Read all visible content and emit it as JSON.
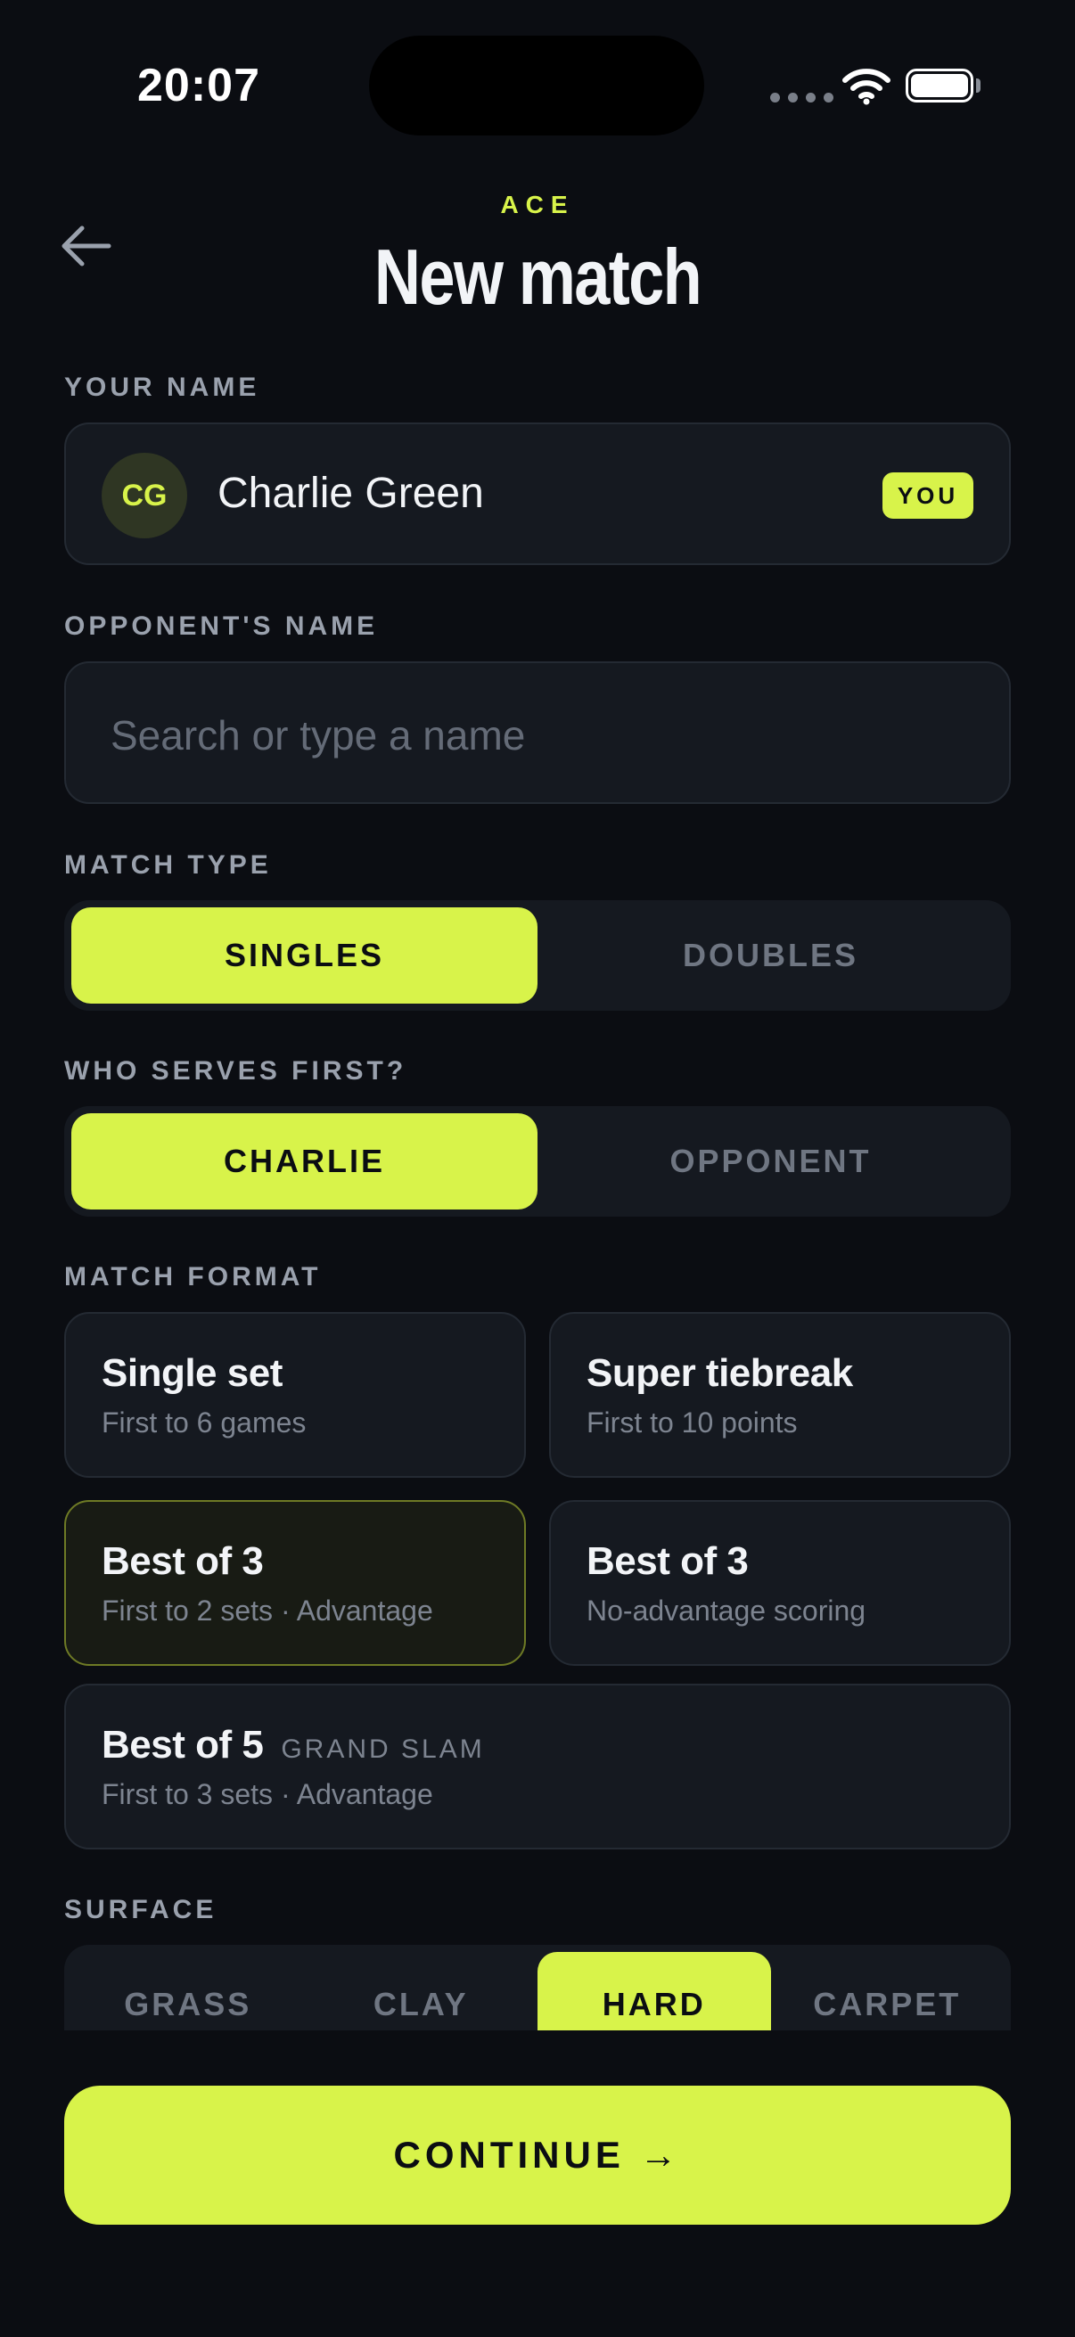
{
  "status": {
    "time": "20:07"
  },
  "header": {
    "brand": "ACE",
    "title": "New match"
  },
  "your_name": {
    "label": "YOUR NAME",
    "initials": "CG",
    "name": "Charlie Green",
    "badge": "YOU"
  },
  "opponent": {
    "label": "OPPONENT'S NAME",
    "placeholder": "Search or type a name",
    "value": ""
  },
  "match_type": {
    "label": "MATCH TYPE",
    "options": [
      "SINGLES",
      "DOUBLES"
    ],
    "selected": "SINGLES"
  },
  "serves_first": {
    "label": "WHO SERVES FIRST?",
    "options": [
      "CHARLIE",
      "OPPONENT"
    ],
    "selected": "CHARLIE"
  },
  "match_format": {
    "label": "MATCH FORMAT",
    "options": [
      {
        "title": "Single set",
        "subtitle": "First to 6 games"
      },
      {
        "title": "Super tiebreak",
        "subtitle": "First to 10 points"
      },
      {
        "title": "Best of 3",
        "subtitle": "First to 2 sets · Advantage"
      },
      {
        "title": "Best of 3",
        "subtitle": "No-advantage scoring"
      },
      {
        "title": "Best of 5",
        "tag": "GRAND SLAM",
        "subtitle": "First to 3 sets · Advantage"
      }
    ],
    "selected_index": 2
  },
  "surface": {
    "label": "SURFACE",
    "options": [
      "GRASS",
      "CLAY",
      "HARD",
      "CARPET"
    ],
    "selected": "HARD"
  },
  "continue_label": "CONTINUE →",
  "colors": {
    "accent": "#d8f34a",
    "background": "#0b0d12",
    "card": "#151920"
  }
}
